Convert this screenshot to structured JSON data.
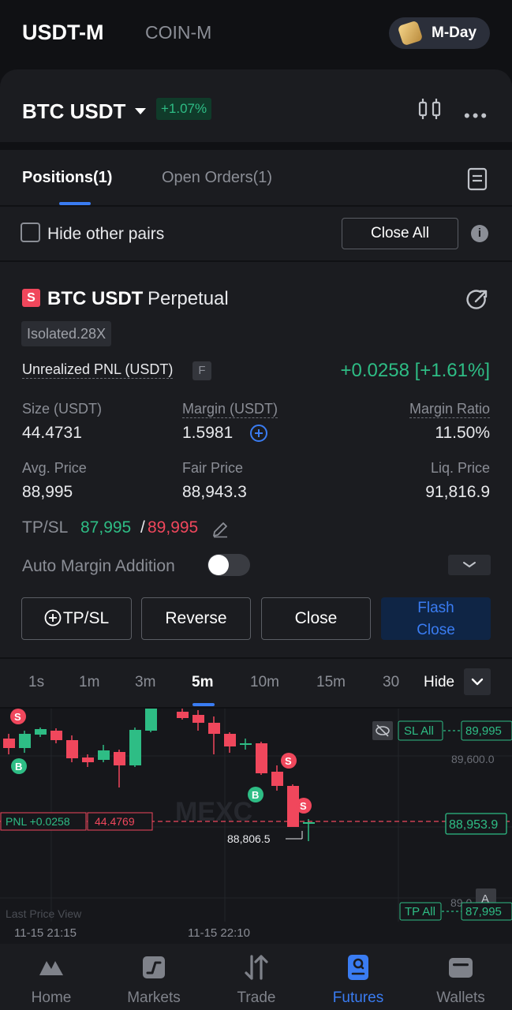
{
  "top_tabs": {
    "active": "USDT-M",
    "other": "COIN-M",
    "promo": "M-Day"
  },
  "symbol": {
    "name": "BTC USDT",
    "change": "+1.07%"
  },
  "panel_tabs": {
    "positions": "Positions(1)",
    "orders": "Open Orders(1)"
  },
  "filter": {
    "hide_label": "Hide other pairs",
    "close_all": "Close All",
    "info": "i"
  },
  "position": {
    "side": "S",
    "symbol": "BTC USDT",
    "type": "Perpetual",
    "margin_mode": "Isolated.28X",
    "pnl_label": "Unrealized PNL (USDT)",
    "pnl_badge": "F",
    "pnl_value": "+0.0258 [+1.61%]",
    "size_label": "Size (USDT)",
    "size": "44.4731",
    "margin_label": "Margin (USDT)",
    "margin": "1.5981",
    "margin_ratio_label": "Margin Ratio",
    "margin_ratio": "11.50%",
    "avg_price_label": "Avg. Price",
    "avg_price": "88,995",
    "fair_price_label": "Fair Price",
    "fair_price": "88,943.3",
    "liq_price_label": "Liq. Price",
    "liq_price": "91,816.9",
    "tpsl_label": "TP/SL",
    "tp": "87,995",
    "slash": "/",
    "sl": "89,995",
    "auto_margin_label": "Auto Margin Addition"
  },
  "actions": {
    "tpsl": "TP/SL",
    "reverse": "Reverse",
    "close": "Close",
    "flash_line1": "Flash",
    "flash_line2": "Close"
  },
  "intervals": [
    "1s",
    "1m",
    "3m",
    "5m",
    "10m",
    "15m",
    "30"
  ],
  "interval_active": "5m",
  "chart_hide": "Hide",
  "chart": {
    "sl_all": "SL All",
    "sl_price": "89,995",
    "tp_all": "TP All",
    "tp_price": "87,995",
    "level_label": "89,600.0",
    "level_label_low": "89,0",
    "pnl_tag": "PNL +0.0258",
    "size_tag": "44.4769",
    "last_price": "88,953.9",
    "low_label": "88,806.5",
    "last_price_view": "Last Price View",
    "time1": "11-15 21:15",
    "time2": "11-15 22:10",
    "marker_s": "S",
    "marker_b": "B",
    "a_badge": "A"
  },
  "nav": [
    "Home",
    "Markets",
    "Trade",
    "Futures",
    "Wallets"
  ],
  "nav_active": "Futures",
  "colors": {
    "up": "#2ebd85",
    "down": "#f0475c",
    "accent": "#3a7cf2",
    "bg": "#1b1c20"
  }
}
